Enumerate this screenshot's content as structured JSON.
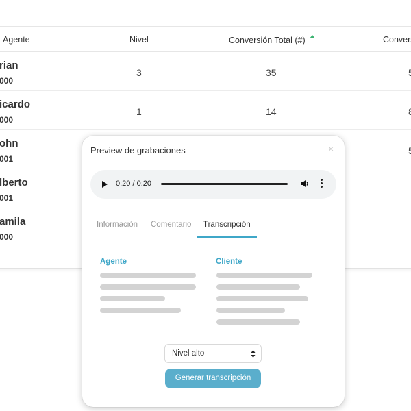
{
  "table": {
    "headers": {
      "agent": "Agente",
      "level": "Nivel",
      "conversion_total": "Conversión Total (#)",
      "conversion_partial": "Convers"
    },
    "rows": [
      {
        "name": "rian",
        "code": "000",
        "level": "3",
        "conversion": "35",
        "conversion2": "5"
      },
      {
        "name": "icardo",
        "code": "000",
        "level": "1",
        "conversion": "14",
        "conversion2": "8"
      },
      {
        "name": "ohn",
        "code": "001",
        "level": "",
        "conversion": "",
        "conversion2": "5"
      },
      {
        "name": "lberto",
        "code": "001",
        "level": "",
        "conversion": "",
        "conversion2": ""
      },
      {
        "name": "amila",
        "code": "000",
        "level": "",
        "conversion": "",
        "conversion2": ""
      }
    ]
  },
  "modal": {
    "title": "Preview de grabaciones",
    "close_icon": "×",
    "player": {
      "time": "0:20 / 0:20",
      "icons": [
        "play-icon",
        "volume-icon",
        "more-vert-icon"
      ]
    },
    "tabs": [
      {
        "label": "Información",
        "active": false
      },
      {
        "label": "Comentario",
        "active": false
      },
      {
        "label": "Transcripción",
        "active": true
      }
    ],
    "transcript": {
      "agent_label": "Agente",
      "client_label": "Cliente"
    },
    "level_select": {
      "value": "Nivel alto"
    },
    "generate_button": "Generar transcripción"
  },
  "colors": {
    "accent": "#3fa7c8",
    "button": "#5aaecc",
    "sort_indicator": "#3cb371",
    "skeleton": "#d3d3d3"
  }
}
